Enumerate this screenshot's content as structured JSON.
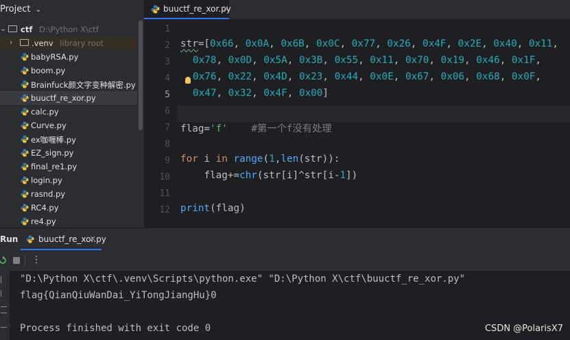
{
  "project_panel": {
    "title": "Project",
    "root": {
      "name": "ctf",
      "path": "D:\\Python X\\ctf"
    },
    "venv": {
      "name": ".venv",
      "hint": "library root"
    },
    "files": [
      "babyRSA.py",
      "boom.py",
      "Brainfuck颜文字变种解密.py",
      "buuctf_re_xor.py",
      "calc.py",
      "Curve.py",
      "ex咖喱棒.py",
      "EZ_sign.py",
      "final_re1.py",
      "login.py",
      "rasnd.py",
      "RC4.py",
      "re4.py"
    ],
    "selected_file": "buuctf_re_xor.py"
  },
  "editor": {
    "tab_label": "buuctf_re_xor.py",
    "close_glyph": "×",
    "line_numbers": [
      "1",
      "2",
      "3",
      "4",
      "5",
      "6",
      "7",
      "8",
      "9",
      "10",
      "11",
      "12"
    ],
    "current_line": "5",
    "str_name": "str",
    "eq_open": "=[",
    "hex_row1": [
      "0x66",
      "0x0A",
      "0x6B",
      "0x0C",
      "0x77",
      "0x26",
      "0x4F",
      "0x2E",
      "0x40",
      "0x11"
    ],
    "hex_row2": [
      "0x78",
      "0x0D",
      "0x5A",
      "0x3B",
      "0x55",
      "0x11",
      "0x70",
      "0x19",
      "0x46",
      "0x1F"
    ],
    "hex_row3": [
      "0x76",
      "0x22",
      "0x4D",
      "0x23",
      "0x44",
      "0x0E",
      "0x67",
      "0x06",
      "0x68",
      "0x0F"
    ],
    "hex_row4": [
      "0x47",
      "0x32",
      "0x4F",
      "0x00"
    ],
    "comma": ", ",
    "close_bracket": "]",
    "flag_var": "flag",
    "flag_assign": "=",
    "flag_init": "'f'",
    "comment": "#第一个f没有处理",
    "kw_for": "for",
    "loop_var": "i",
    "kw_in": "in",
    "fn_range": "range",
    "range_open": "(",
    "range_start": "1",
    "range_sep": ",",
    "fn_len": "len",
    "len_args": "(str)):",
    "indent": "    ",
    "flag_plus": "flag+=",
    "fn_chr": "chr",
    "chr_args_a": "(str[i]^str[i-",
    "chr_one": "1",
    "chr_args_b": "])",
    "fn_print": "print",
    "print_args": "(flag)"
  },
  "run_panel": {
    "title": "Run",
    "tab_label": "buuctf_re_xor.py",
    "close_glyph": "×",
    "more_glyph": "⋮",
    "output": [
      "\"D:\\Python X\\ctf\\.venv\\Scripts\\python.exe\" \"D:\\Python X\\ctf\\buuctf_re_xor.py\"",
      "flag{QianQiuWanDai_YiTongJiangHu}0",
      "",
      "Process finished with exit code 0"
    ]
  },
  "watermark": "CSDN @PolarisX7",
  "colors": {
    "background": "#1e1f22",
    "panel": "#2b2d30",
    "number": "#2aacb8",
    "keyword": "#cf8e6d",
    "string": "#6aab73",
    "accent": "#3574f0"
  }
}
